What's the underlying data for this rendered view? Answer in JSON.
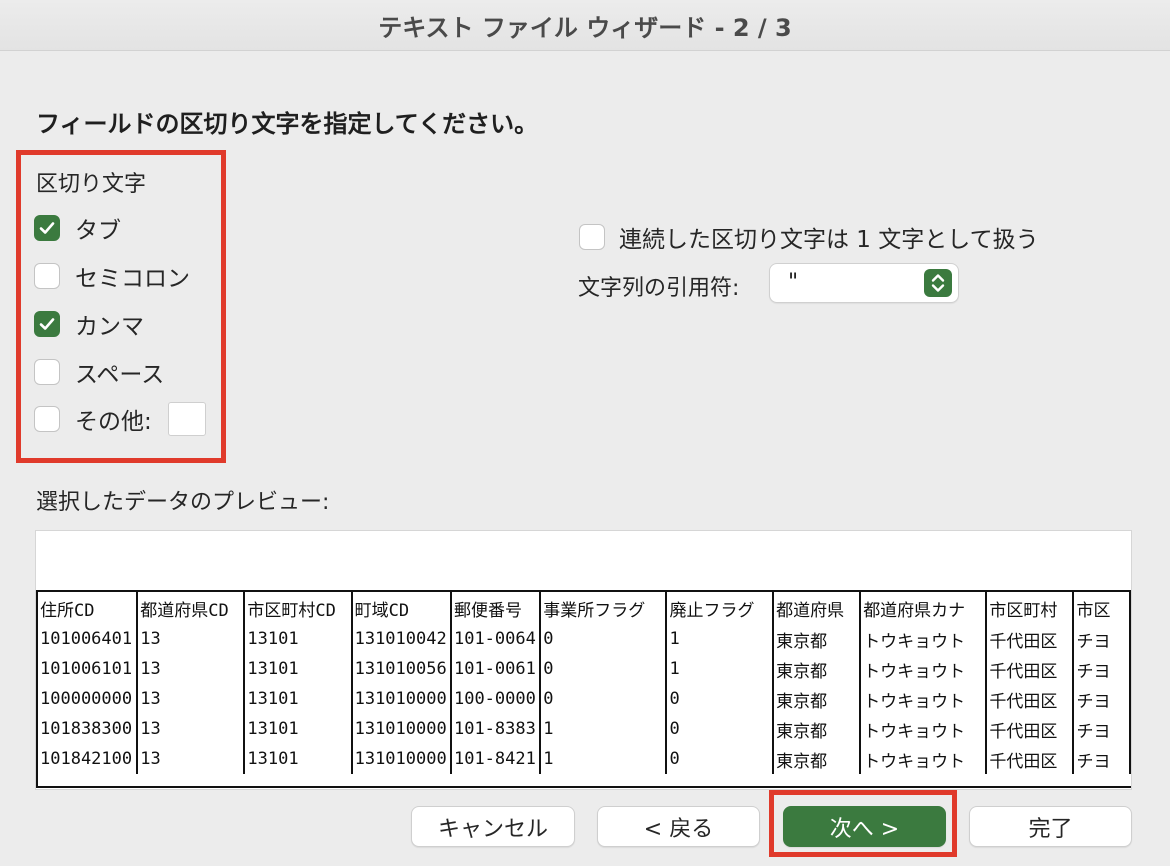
{
  "window": {
    "title": "テキスト ファイル ウィザード - 2 / 3"
  },
  "instruction": "フィールドの区切り文字を指定してください。",
  "delimiters": {
    "label": "区切り文字",
    "tab": {
      "label": "タブ",
      "checked": true
    },
    "semicolon": {
      "label": "セミコロン",
      "checked": false
    },
    "comma": {
      "label": "カンマ",
      "checked": true
    },
    "space": {
      "label": "スペース",
      "checked": false
    },
    "other": {
      "label": "その他:",
      "checked": false,
      "value": ""
    }
  },
  "options": {
    "consecutive": {
      "label": "連続した区切り文字は 1 文字として扱う",
      "checked": false
    },
    "text_qualifier": {
      "label": "文字列の引用符:",
      "value": "\""
    }
  },
  "preview": {
    "label": "選択したデータのプレビュー:",
    "headers": [
      "住所CD",
      "都道府県CD",
      "市区町村CD",
      "町域CD",
      "郵便番号",
      "事業所フラグ",
      "廃止フラグ",
      "都道府県",
      "都道府県カナ",
      "市区町村",
      "市区"
    ],
    "rows": [
      [
        "101006401",
        "13",
        "13101",
        "131010042",
        "101-0064",
        "0",
        "1",
        "東京都",
        "トウキョウト",
        "千代田区",
        "チヨ"
      ],
      [
        "101006101",
        "13",
        "13101",
        "131010056",
        "101-0061",
        "0",
        "1",
        "東京都",
        "トウキョウト",
        "千代田区",
        "チヨ"
      ],
      [
        "100000000",
        "13",
        "13101",
        "131010000",
        "100-0000",
        "0",
        "0",
        "東京都",
        "トウキョウト",
        "千代田区",
        "チヨ"
      ],
      [
        "101838300",
        "13",
        "13101",
        "131010000",
        "101-8383",
        "1",
        "0",
        "東京都",
        "トウキョウト",
        "千代田区",
        "チヨ"
      ],
      [
        "101842100",
        "13",
        "13101",
        "131010000",
        "101-8421",
        "1",
        "0",
        "東京都",
        "トウキョウト",
        "千代田区",
        "チヨ"
      ]
    ]
  },
  "buttons": {
    "cancel": "キャンセル",
    "back": "< 戻る",
    "next": "次へ >",
    "finish": "完了"
  },
  "colors": {
    "accent": "#3b7a3f",
    "highlight": "#e03a2b"
  },
  "icons": {
    "checkbox_check": "checkmark-icon",
    "select_stepper": "chevron-up-down-icon"
  }
}
